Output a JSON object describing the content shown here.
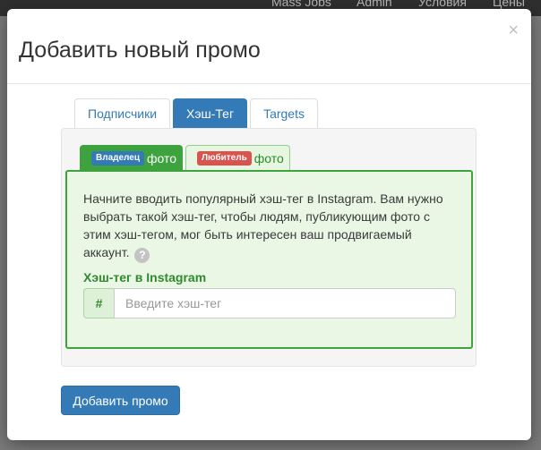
{
  "background": {
    "nav_items": [
      "Mass Jobs",
      "Admin",
      "Условия",
      "Цены"
    ]
  },
  "modal": {
    "title": "Добавить новый промо",
    "close_symbol": "×"
  },
  "tabs": [
    {
      "label": "Подписчики",
      "active": false
    },
    {
      "label": "Хэш-Тег",
      "active": true
    },
    {
      "label": "Targets",
      "active": false
    }
  ],
  "subtabs": [
    {
      "badge": "Владелец",
      "label": "фото",
      "active": true
    },
    {
      "badge": "Любитель",
      "label": "фото",
      "active": false
    }
  ],
  "hashtag_panel": {
    "description": "Начните вводить популярный хэш-тег в Instagram. Вам нужно выбрать такой хэш-тег, чтобы людям, публикующим фото с этим хэш-тегом, мог быть интересен ваш продвигаемый аккаунт.",
    "help_symbol": "?",
    "field_label": "Хэш-тег в Instagram",
    "addon": "#",
    "input_value": "",
    "input_placeholder": "Введите хэш-тег"
  },
  "submit_label": "Добавить промо",
  "colors": {
    "primary": "#337ab7",
    "success": "#3ea33e",
    "danger": "#d9534f"
  }
}
